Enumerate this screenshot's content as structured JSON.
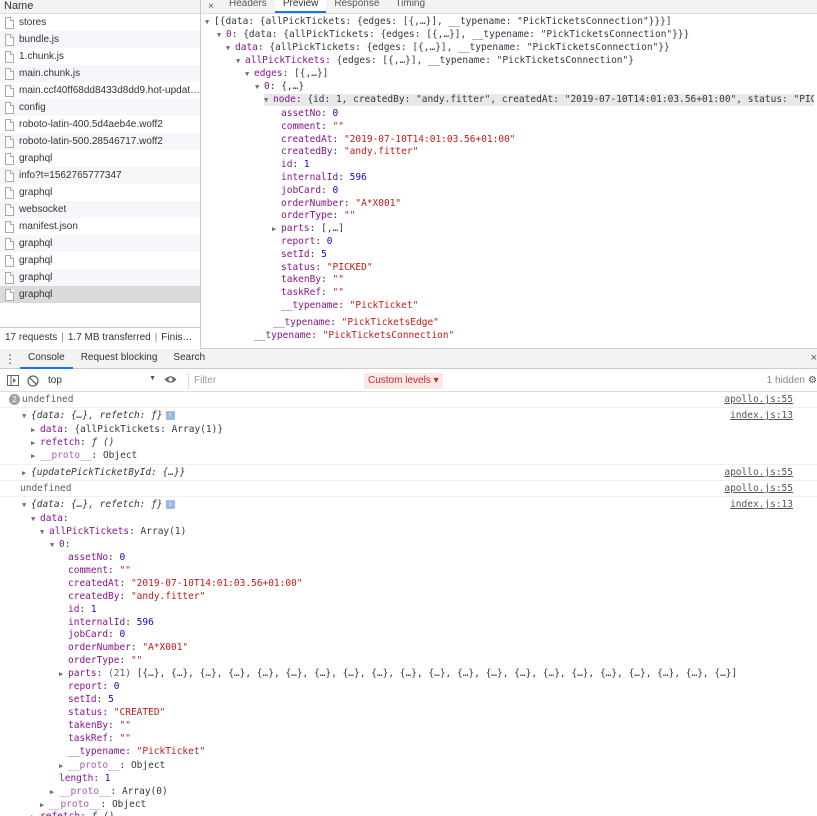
{
  "network": {
    "name_header": "Name",
    "requests": [
      "stores",
      "bundle.js",
      "1.chunk.js",
      "main.chunk.js",
      "main.ccf40ff68dd8433d8dd9.hot-updat…",
      "config",
      "roboto-latin-400.5d4aeb4e.woff2",
      "roboto-latin-500.28546717.woff2",
      "graphql",
      "info?t=1562765777347",
      "graphql",
      "websocket",
      "manifest.json",
      "graphql",
      "graphql",
      "graphql",
      "graphql"
    ],
    "status": {
      "requests": "17 requests",
      "transferred": "1.7 MB transferred",
      "finish": "Finis…"
    },
    "tabs": [
      "Headers",
      "Preview",
      "Response",
      "Timing"
    ],
    "close_glyph": "×"
  },
  "preview": {
    "root": "[{data: {allPickTickets: {edges: [{,…}], __typename: \"PickTicketsConnection\"}}}]",
    "item0_key": "0",
    "item0": "{data: {allPickTickets: {edges: [{,…}], __typename: \"PickTicketsConnection\"}}}",
    "data_key": "data",
    "data": "{allPickTickets: {edges: [{,…}], __typename: \"PickTicketsConnection\"}}",
    "apt_key": "allPickTickets",
    "apt": "{edges: [{,…}], __typename: \"PickTicketsConnection\"}",
    "edges_key": "edges",
    "edges": "[{,…}]",
    "edge0_key": "0",
    "edge0": "{,…}",
    "node_key": "node",
    "node": "{id: 1, createdBy: \"andy.fitter\", createdAt: \"2019-07-10T14:01:03.56+01:00\", status: \"PICKED\",…}",
    "fields": {
      "assetNo": "0",
      "comment": "\"\"",
      "createdAt": "\"2019-07-10T14:01:03.56+01:00\"",
      "createdBy": "\"andy.fitter\"",
      "id": "1",
      "internalId": "596",
      "jobCard": "0",
      "orderNumber": "\"A*X001\"",
      "orderType": "\"\"",
      "parts": "[,…]",
      "report": "0",
      "setId": "5",
      "status": "\"PICKED\"",
      "takenBy": "\"\"",
      "taskRef": "\"\"",
      "node_typename": "\"PickTicket\""
    },
    "edge_typename": "\"PickTicketsEdge\"",
    "conn_typename": "\"PickTicketsConnection\"",
    "typename_key": "__typename"
  },
  "drawer": {
    "tabs": [
      "Console",
      "Request blocking",
      "Search"
    ],
    "close_glyph": "×",
    "context": "top",
    "filter_placeholder": "Filter",
    "levels": "Custom levels ▾",
    "hidden": "1 hidden"
  },
  "console": {
    "undef_count": "2",
    "undefined": "undefined",
    "src_apollo": "apollo.js:55",
    "src_index": "index.js:13",
    "obj_summary": "{data: {…}, refetch: ƒ}",
    "info_glyph": "i",
    "data_line": "data: {allPickTickets: Array(1)}",
    "data_key": "data",
    "data_val": "{allPickTickets: Array(1)}",
    "refetch_key": "refetch",
    "refetch_val": "ƒ ()",
    "proto_key": "__proto__",
    "proto_object": "Object",
    "update_summary": "{updatePickTicketById: {…}}",
    "apt_key": "allPickTickets",
    "apt_val": "Array(1)",
    "idx0": "0",
    "fields": {
      "assetNo": "0",
      "comment": "\"\"",
      "createdAt": "\"2019-07-10T14:01:03.56+01:00\"",
      "createdBy": "\"andy.fitter\"",
      "id": "1",
      "internalId": "596",
      "jobCard": "0",
      "orderNumber": "\"A*X001\"",
      "orderType": "\"\"",
      "parts_count": "(21)",
      "parts_val": "[{…}, {…}, {…}, {…}, {…}, {…}, {…}, {…}, {…}, {…}, {…}, {…}, {…}, {…}, {…}, {…}, {…}, {…}, {…}, {…}, {…}]",
      "report": "0",
      "setId": "5",
      "status": "\"CREATED\"",
      "takenBy": "\"\"",
      "taskRef": "\"\"",
      "typename": "\"PickTicket\""
    },
    "length_key": "length",
    "length_val": "1",
    "proto_array": "Array(0)"
  }
}
